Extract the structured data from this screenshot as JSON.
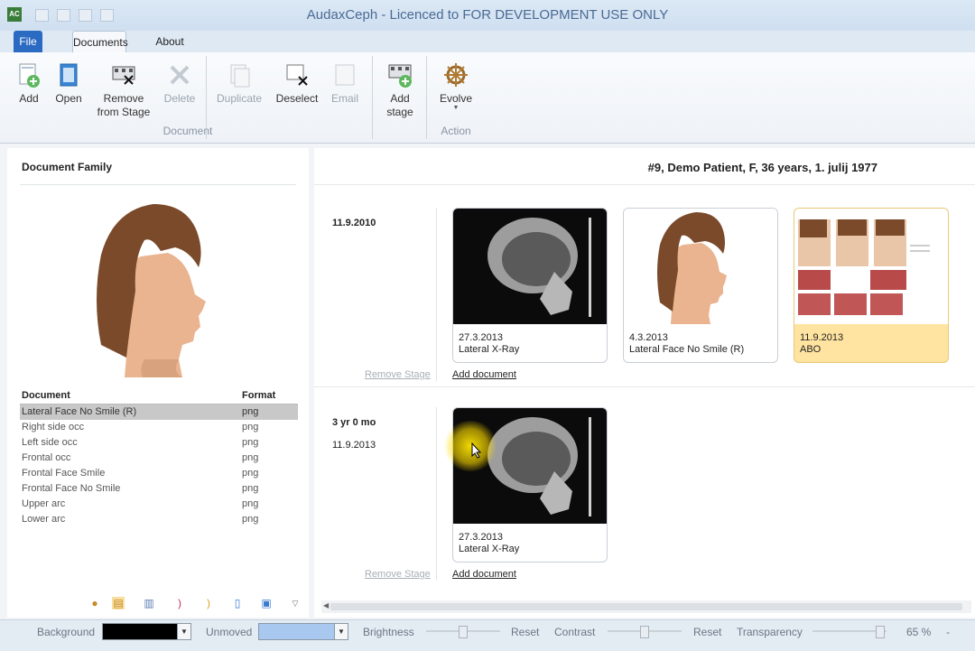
{
  "window": {
    "title": "AudaxCeph - Licenced to FOR DEVELOPMENT USE ONLY",
    "app_icon_text": "AC"
  },
  "tabs": [
    "File",
    "Documents",
    "About"
  ],
  "ribbon": {
    "document_group": "Document",
    "action_group": "Action",
    "buttons": {
      "add": "Add",
      "open": "Open",
      "remove_from_stage": "Remove from Stage",
      "delete": "Delete",
      "duplicate": "Duplicate",
      "deselect": "Deselect",
      "email": "Email",
      "add_stage": "Add stage",
      "evolve": "Evolve"
    }
  },
  "left_panel": {
    "title": "Document Family",
    "table_headers": [
      "Document",
      "Format"
    ],
    "rows": [
      {
        "document": "Lateral Face No Smile (R)",
        "format": "png",
        "selected": true
      },
      {
        "document": "Right side occ",
        "format": "png"
      },
      {
        "document": "Left side occ",
        "format": "png"
      },
      {
        "document": "Frontal occ",
        "format": "png"
      },
      {
        "document": "Frontal Face Smile",
        "format": "png"
      },
      {
        "document": "Frontal Face No Smile",
        "format": "png"
      },
      {
        "document": "Upper arc",
        "format": "png"
      },
      {
        "document": "Lower arc",
        "format": "png"
      }
    ]
  },
  "patient": {
    "header": "#9,   Demo Patient,   F,   36 years,   1. julij 1977"
  },
  "stages": [
    {
      "date": "11.9.2010",
      "cards": [
        {
          "date": "27.3.2013",
          "name": "Lateral X-Ray"
        },
        {
          "date": "4.3.2013",
          "name": "Lateral Face No Smile (R)"
        },
        {
          "date": "11.9.2013",
          "name": "ABO"
        }
      ],
      "remove_label": "Remove Stage",
      "add_label": "Add document"
    },
    {
      "age": "3 yr 0 mo",
      "date": "11.9.2013",
      "cards": [
        {
          "date": "27.3.2013",
          "name": "Lateral X-Ray"
        }
      ],
      "remove_label": "Remove Stage",
      "add_label": "Add document"
    }
  ],
  "statusbar": {
    "background_label": "Background",
    "background_color": "#000000",
    "unmoved_label": "Unmoved",
    "unmoved_color": "#a8c8f0",
    "brightness_label": "Brightness",
    "reset1": "Reset",
    "contrast_label": "Contrast",
    "reset2": "Reset",
    "transparency_label": "Transparency",
    "zoom": "65 %",
    "minus": "-"
  },
  "colors": {
    "accent": "#2b6ac3",
    "highlight_card": "#ffe3a0",
    "selected_row": "#c8c8c8"
  }
}
